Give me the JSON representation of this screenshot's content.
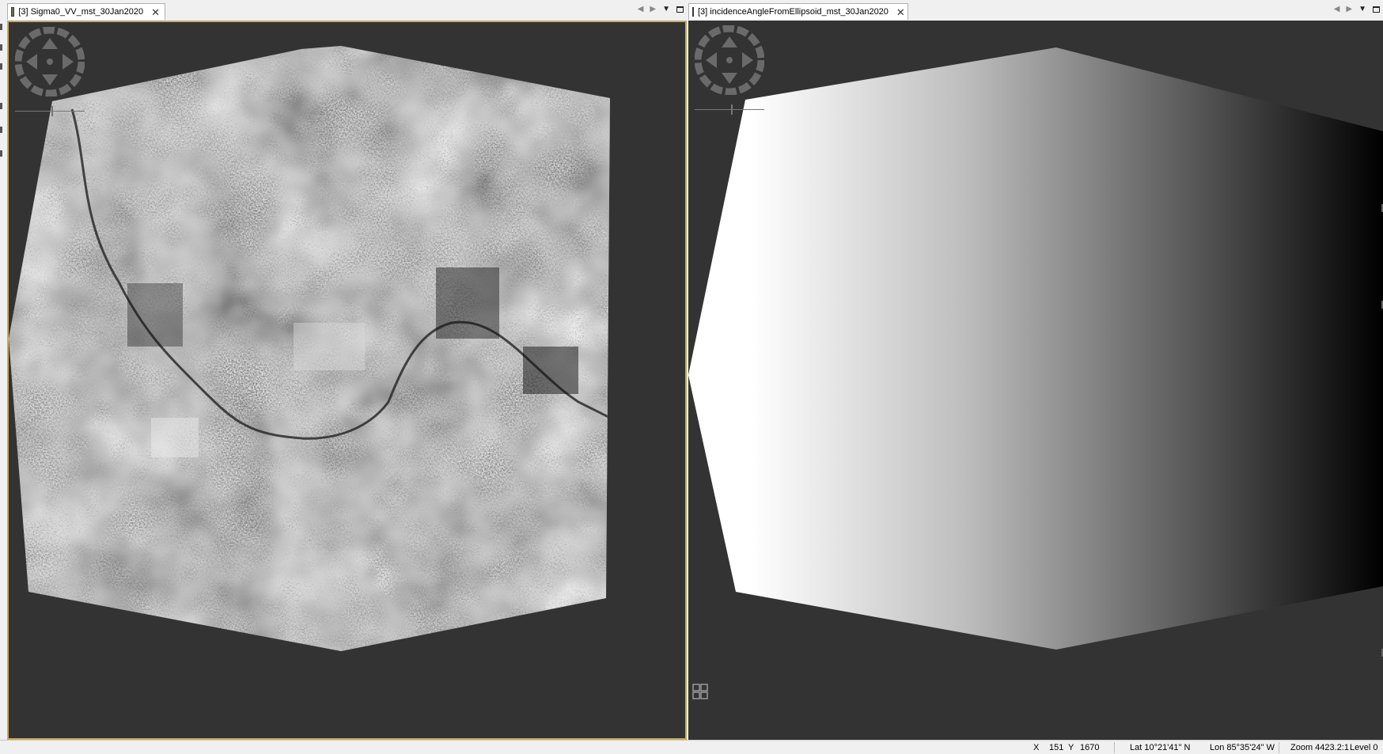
{
  "left_view": {
    "tab_label": "[3] Sigma0_VV_mst_30Jan2020",
    "close_glyph": "✕",
    "image_kind": "sar-amplitude-grayscale"
  },
  "right_view": {
    "tab_label": "[3] incidenceAngleFromEllipsoid_mst_30Jan2020",
    "close_glyph": "✕",
    "image_kind": "incidence-angle-gradient"
  },
  "tab_controls": {
    "prev": "◀",
    "next": "▶",
    "menu": "▼"
  },
  "status": {
    "x_label": "X",
    "x_value": "151",
    "y_label": "Y",
    "y_value": "1670",
    "lat": "Lat 10°21'41\" N",
    "lon": "Lon 85°35'24\" W",
    "zoom": "Zoom 4423.2:1",
    "level": "Level 0"
  },
  "colors": {
    "viewport_bg": "#333333",
    "selected_border": "#c9a951",
    "chrome_bg": "#f0f0f0"
  },
  "icons": [
    "navigation-control-icon",
    "layer-manager-icon",
    "maximize-icon",
    "view-menu-icon"
  ]
}
